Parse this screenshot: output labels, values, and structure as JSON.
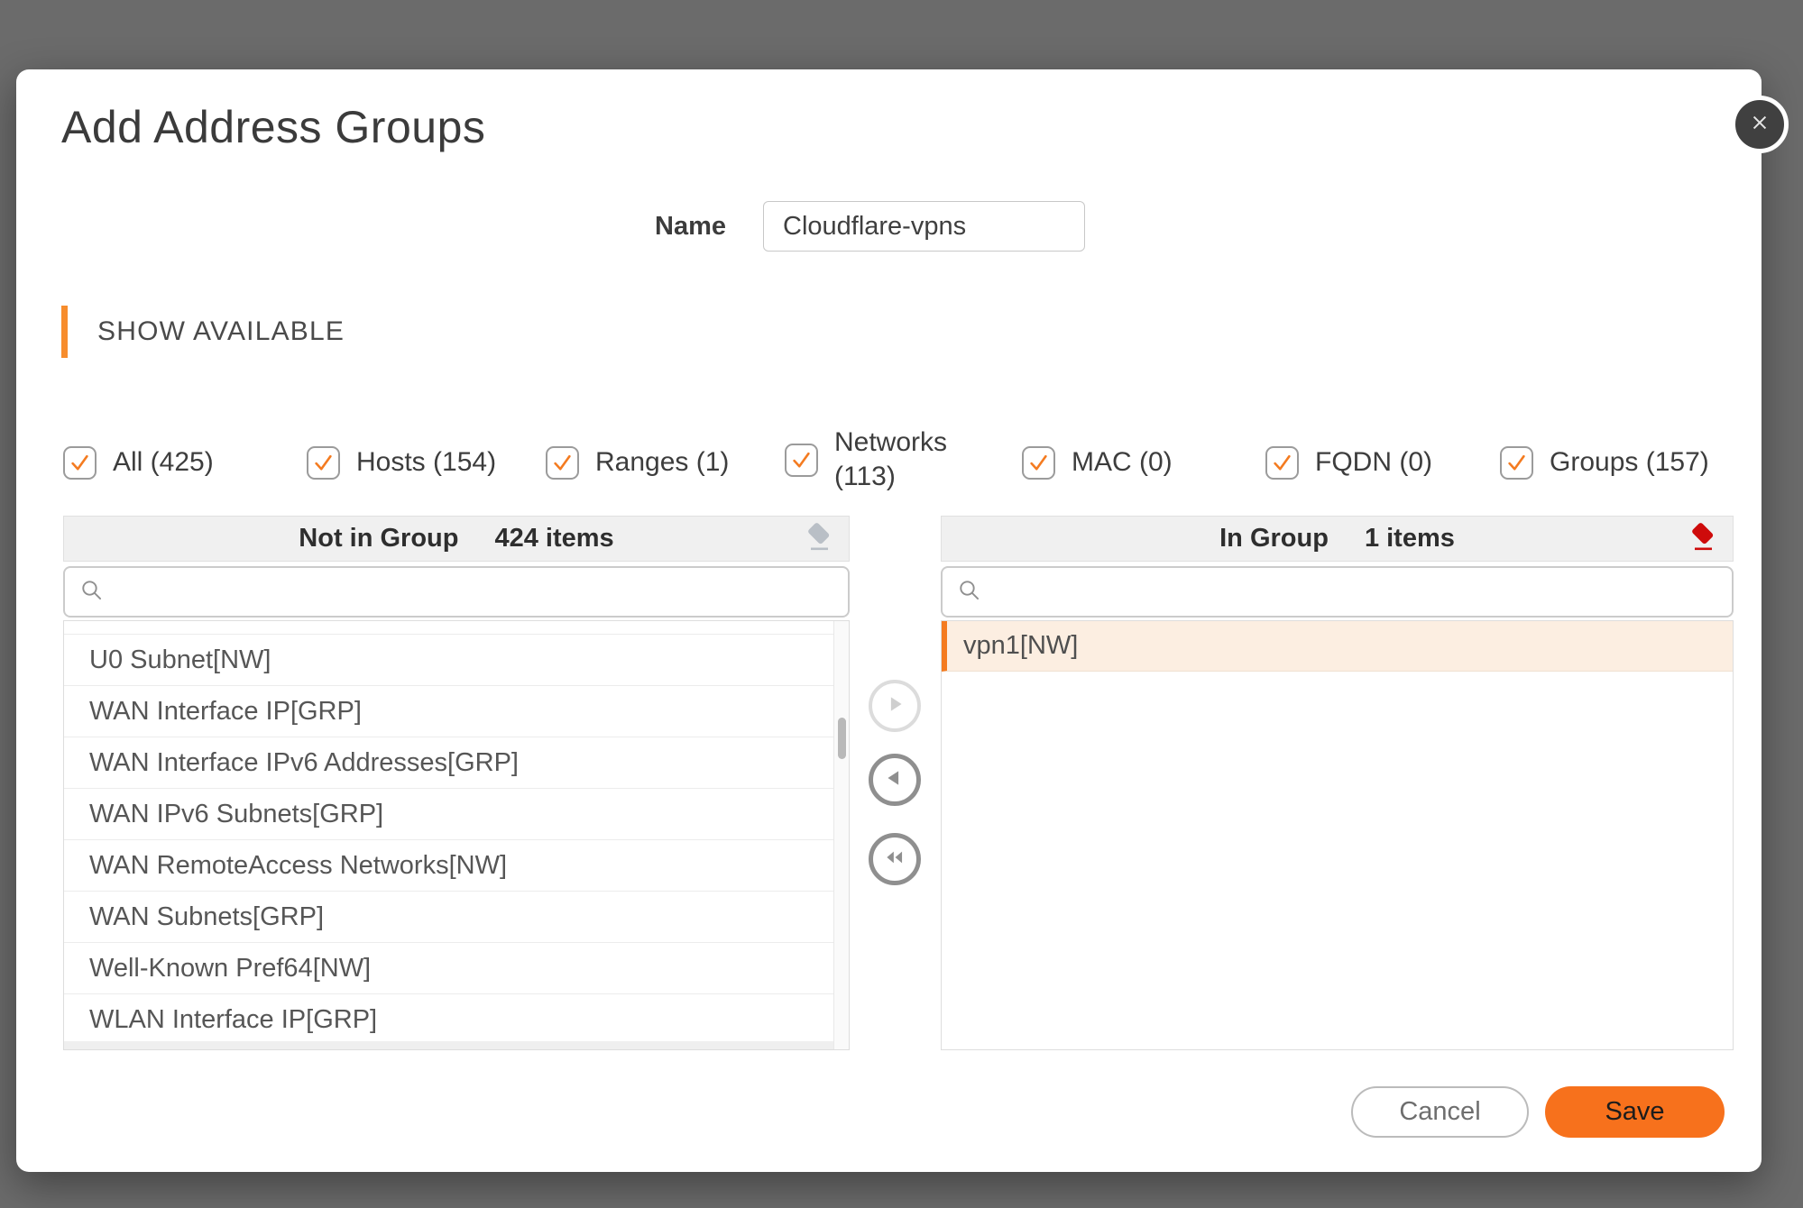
{
  "dialog": {
    "title": "Add Address Groups"
  },
  "form": {
    "name_label": "Name",
    "name_value": "Cloudflare-vpns",
    "name_placeholder": ""
  },
  "section": {
    "label": "SHOW AVAILABLE"
  },
  "filters": [
    {
      "label": "All (425)",
      "checked": true
    },
    {
      "label": "Hosts (154)",
      "checked": true
    },
    {
      "label": "Ranges (1)",
      "checked": true
    },
    {
      "label": "Networks (113)",
      "checked": true
    },
    {
      "label": "MAC (0)",
      "checked": true
    },
    {
      "label": "FQDN (0)",
      "checked": true
    },
    {
      "label": "Groups (157)",
      "checked": true
    }
  ],
  "not_in_group": {
    "title": "Not in Group",
    "count": "424 items",
    "search_value": "",
    "search_placeholder": "",
    "items": [
      "U0 Subnet[NW]",
      "WAN Interface IP[GRP]",
      "WAN Interface IPv6 Addresses[GRP]",
      "WAN IPv6 Subnets[GRP]",
      "WAN RemoteAccess Networks[NW]",
      "WAN Subnets[GRP]",
      "Well-Known Pref64[NW]",
      "WLAN Interface IP[GRP]"
    ]
  },
  "in_group": {
    "title": "In Group",
    "count": "1 items",
    "search_value": "",
    "search_placeholder": "",
    "items": [
      "vpn1[NW]"
    ]
  },
  "footer": {
    "cancel_label": "Cancel",
    "save_label": "Save"
  },
  "colors": {
    "accent_orange": "#F47B20",
    "section_bar_orange": "#F78D2D",
    "save_button_orange": "#F7711C",
    "eraser_red": "#CE0B0B",
    "eraser_grey": "#B9BFC6",
    "selected_row_bg": "#FCEEE1",
    "overlay_background": "#6B6B6B"
  }
}
